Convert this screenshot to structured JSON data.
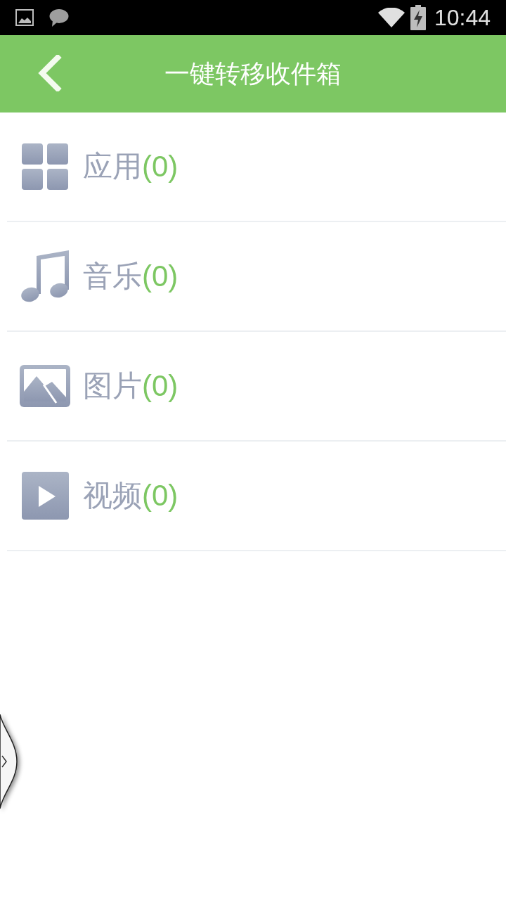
{
  "status_bar": {
    "time": "10:44"
  },
  "header": {
    "title": "一键转移收件箱"
  },
  "categories": [
    {
      "kind": "apps",
      "label": "应用",
      "count": "(0)"
    },
    {
      "kind": "music",
      "label": "音乐",
      "count": "(0)"
    },
    {
      "kind": "pictures",
      "label": "图片",
      "count": "(0)"
    },
    {
      "kind": "videos",
      "label": "视频",
      "count": "(0)"
    }
  ]
}
